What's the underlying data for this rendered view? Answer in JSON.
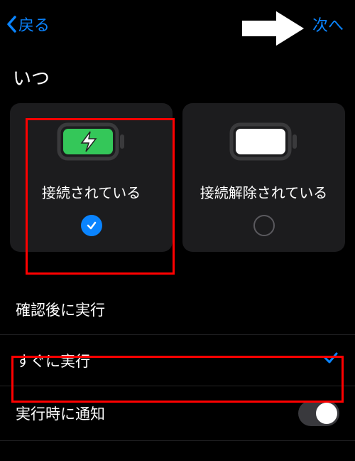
{
  "nav": {
    "back_label": "戻る",
    "next_label": "次へ"
  },
  "section_title": "いつ",
  "options": {
    "connected": {
      "label": "接続されている",
      "selected": true
    },
    "disconnected": {
      "label": "接続解除されている",
      "selected": false
    }
  },
  "rows": {
    "confirm_run": {
      "label": "確認後に実行"
    },
    "run_now": {
      "label": "すぐに実行",
      "checked": true
    },
    "notify": {
      "label": "実行時に通知",
      "toggle_on": false
    }
  }
}
